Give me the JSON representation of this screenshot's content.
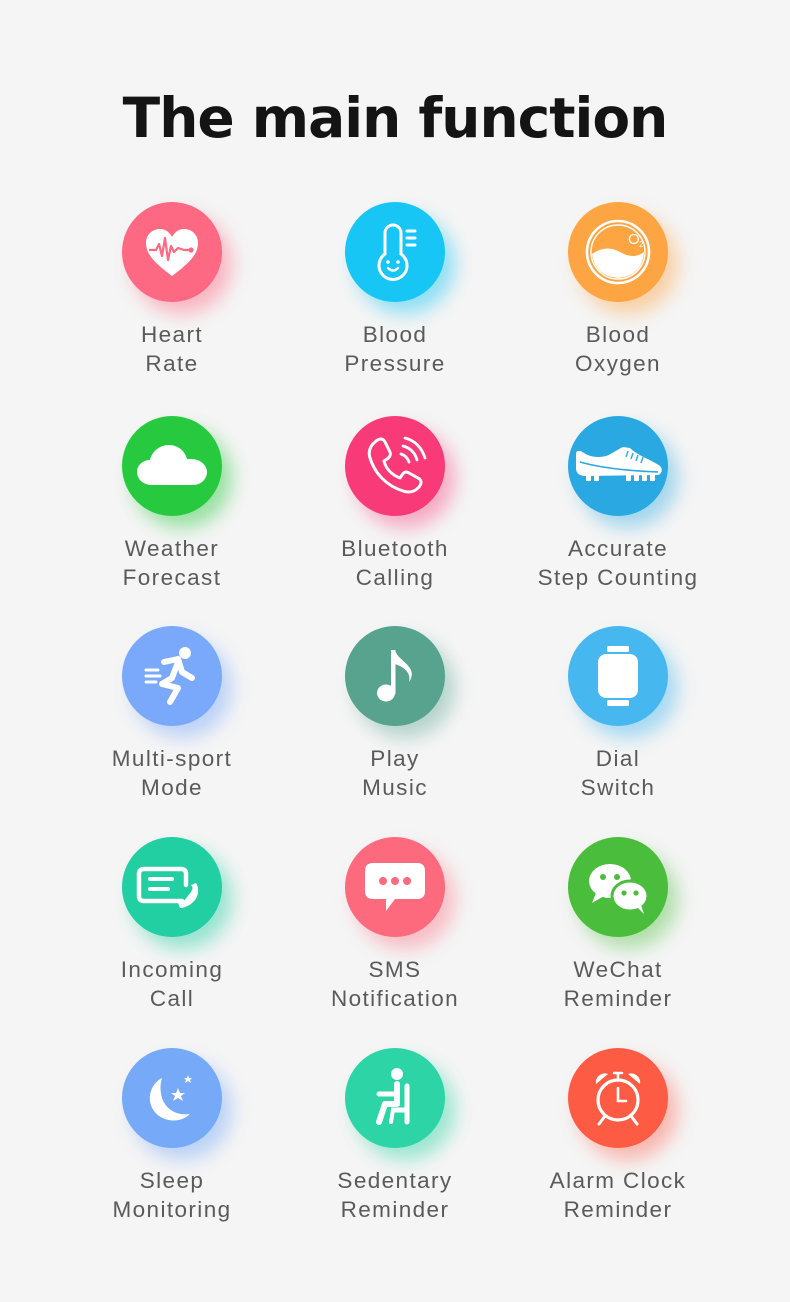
{
  "title": "The main function",
  "features": [
    {
      "id": "heart-rate",
      "icon": "heart-rate-icon",
      "color": "#fd6882",
      "glow": "rgba(253,104,130,0.45)",
      "line1": "Heart",
      "line2": "Rate"
    },
    {
      "id": "blood-pressure",
      "icon": "thermometer-icon",
      "color": "#17c6f4",
      "glow": "rgba(23,198,244,0.45)",
      "line1": "Blood",
      "line2": "Pressure"
    },
    {
      "id": "blood-oxygen",
      "icon": "oxygen-icon",
      "color": "#fda543",
      "glow": "rgba(253,165,67,0.45)",
      "line1": "Blood",
      "line2": "Oxygen"
    },
    {
      "id": "weather-forecast",
      "icon": "cloud-icon",
      "color": "#27c93f",
      "glow": "rgba(39,201,63,0.45)",
      "line1": "Weather",
      "line2": "Forecast"
    },
    {
      "id": "bluetooth-calling",
      "icon": "phone-call-icon",
      "color": "#f83a78",
      "glow": "rgba(248,58,120,0.4)",
      "line1": "Bluetooth",
      "line2": "Calling"
    },
    {
      "id": "step-counting",
      "icon": "sneaker-icon",
      "color": "#29a8e1",
      "glow": "rgba(41,168,225,0.4)",
      "line1": "Accurate",
      "line2": "Step Counting"
    },
    {
      "id": "multi-sport-mode",
      "icon": "running-person-icon",
      "color": "#7aa9fb",
      "glow": "rgba(122,169,251,0.45)",
      "line1": "Multi-sport",
      "line2": "Mode"
    },
    {
      "id": "play-music",
      "icon": "music-note-icon",
      "color": "#57a38e",
      "glow": "rgba(87,163,142,0.4)",
      "line1": "Play",
      "line2": "Music"
    },
    {
      "id": "dial-switch",
      "icon": "watch-icon",
      "color": "#47b7ef",
      "glow": "rgba(71,183,239,0.45)",
      "line1": "Dial",
      "line2": "Switch"
    },
    {
      "id": "incoming-call",
      "icon": "incoming-call-icon",
      "color": "#21cfa2",
      "glow": "rgba(33,207,162,0.45)",
      "line1": "Incoming",
      "line2": "Call"
    },
    {
      "id": "sms-notification",
      "icon": "chat-bubble-icon",
      "color": "#fd6a7d",
      "glow": "rgba(253,106,125,0.4)",
      "line1": "SMS",
      "line2": "Notification"
    },
    {
      "id": "wechat-reminder",
      "icon": "wechat-icon",
      "color": "#4bbd3c",
      "glow": "rgba(75,189,60,0.4)",
      "line1": "WeChat",
      "line2": "Reminder"
    },
    {
      "id": "sleep-monitoring",
      "icon": "moon-stars-icon",
      "color": "#76a9f8",
      "glow": "rgba(118,169,248,0.45)",
      "line1": "Sleep",
      "line2": "Monitoring"
    },
    {
      "id": "sedentary-reminder",
      "icon": "seated-person-icon",
      "color": "#2dd4a5",
      "glow": "rgba(45,212,165,0.45)",
      "line1": "Sedentary",
      "line2": "Reminder"
    },
    {
      "id": "alarm-clock-reminder",
      "icon": "alarm-clock-icon",
      "color": "#fe5b45",
      "glow": "rgba(254,91,69,0.4)",
      "line1": "Alarm Clock",
      "line2": "Reminder"
    }
  ]
}
